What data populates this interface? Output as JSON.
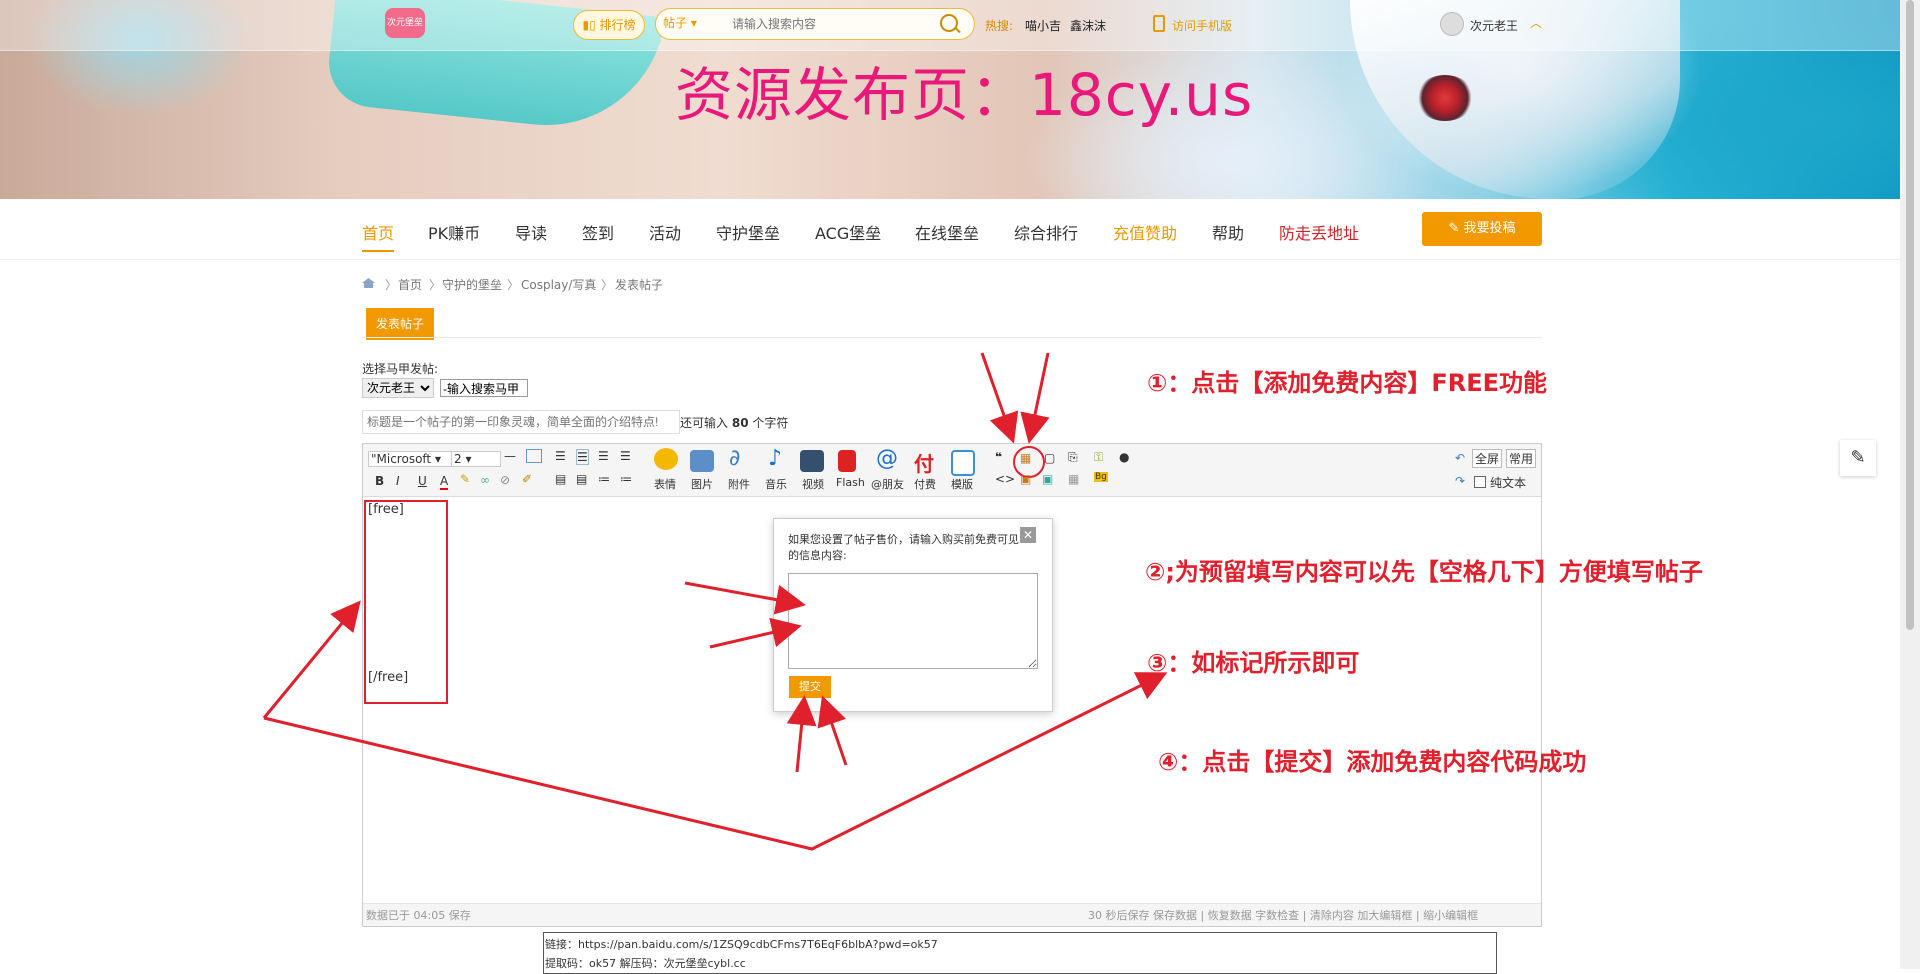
{
  "header": {
    "logo_text": "次元堡垒",
    "rank_label": "▮▯ 排行榜",
    "search_type": "帖子 ▾",
    "search_placeholder": "请输入搜索内容",
    "hot_label": "热搜:",
    "hot_words": [
      "喵小吉",
      "鑫沫沫"
    ],
    "mobile_label": "访问手机版",
    "user_name": "次元老王",
    "watermark": "资源发布页：18cy.us"
  },
  "nav": {
    "items": [
      "首页",
      "PK赚币",
      "导读",
      "签到",
      "活动",
      "守护堡垒",
      "ACG堡垒",
      "在线堡垒",
      "综合排行",
      "充值赞助",
      "帮助",
      "防走丢地址"
    ],
    "post_button": "✎ 我要投稿"
  },
  "breadcrumb": [
    "首页",
    "守护的堡垒",
    "Cosplay/写真",
    "发表帖子"
  ],
  "form": {
    "tab_label": "发表帖子",
    "alias_label": "选择马甲发帖:",
    "alias_value": "次元老王",
    "alias_search": "-输入搜索马甲",
    "title_placeholder": "标题是一个帖子的第一印象灵魂，简单全面的介绍特点!",
    "title_remain_prefix": "还可输入",
    "title_remain_count": "80",
    "title_remain_suffix": "个字符"
  },
  "toolbar": {
    "font": "\"Microsoft ▾",
    "size": "2 ▾",
    "format_buttons": [
      "B",
      "I",
      "U",
      "A"
    ],
    "labeled_buttons": [
      "表情",
      "图片",
      "附件",
      "音乐",
      "视频",
      "Flash",
      "@朋友",
      "付费",
      "模版"
    ],
    "fullscreen": "全屏",
    "common": "常用",
    "plaintext": "纯文本"
  },
  "editor": {
    "content_start": "[free]",
    "content_end": "[/free]",
    "status_left": "数据已于 04:05 保存",
    "status_right": "30 秒后保存 保存数据 | 恢复数据    字数检查 | 清除内容    加大编辑框 | 缩小编辑框"
  },
  "popup": {
    "text": "如果您设置了帖子售价，请输入购买前免费可见的信息内容:",
    "close": "✕",
    "submit": "提交"
  },
  "annotations": [
    "①：点击【添加免费内容】FREE功能",
    "②;为预留填写内容可以先【空格几下】方便填写帖子",
    "③：如标记所示即可",
    "④：点击【提交】添加免费内容代码成功"
  ],
  "footer_box": {
    "link": "链接：https://pan.baidu.com/s/1ZSQ9cdbCFms7T6EqF6blbA?pwd=ok57",
    "code": "提取码：ok57 解压码：次元堡垒cybl.cc"
  },
  "colors": {
    "accent": "#f29900",
    "annotation": "#e0202c",
    "watermark": "#e8197b"
  }
}
